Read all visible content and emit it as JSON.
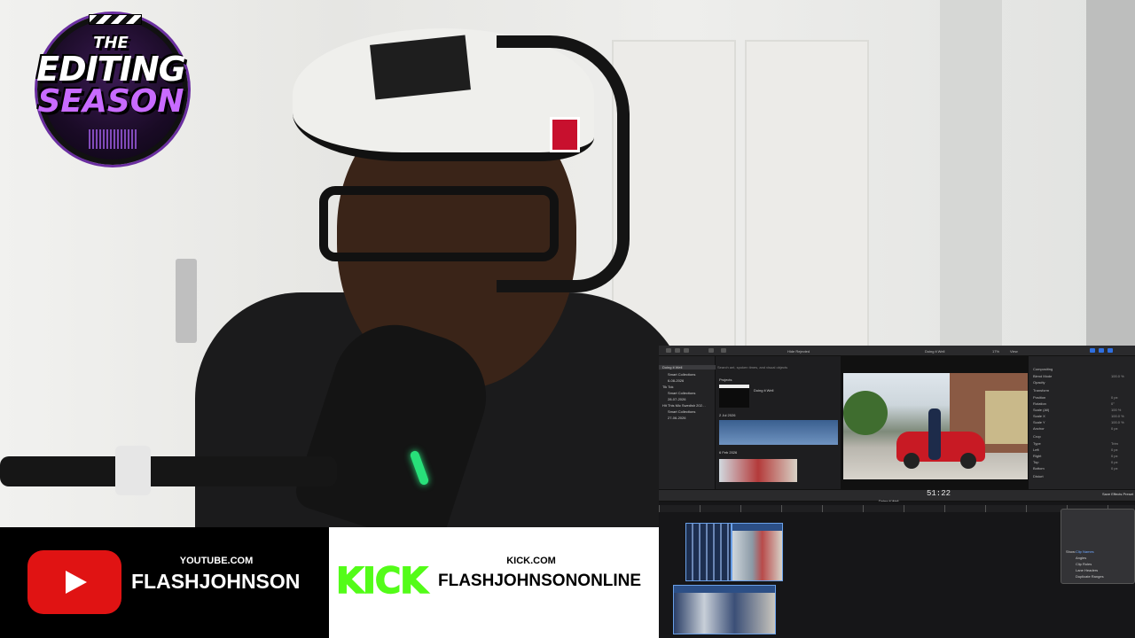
{
  "overlay": {
    "logo": {
      "line1": "THE",
      "line2": "EDITING",
      "line3": "SEASON"
    },
    "banner": {
      "youtube": {
        "platform_url": "YOUTUBE.COM",
        "channel": "FLASHJOHNSON",
        "brand_color": "#e01313"
      },
      "kick": {
        "logo_text": "KICK",
        "platform_url": "KICK.COM",
        "channel": "FLASHJOHNSONONLINE",
        "brand_color": "#53fc18"
      }
    }
  },
  "editor": {
    "toolbar": {
      "hide_rejected": "Hide Rejected",
      "project_name": "Doing it Well",
      "zoom": "17%",
      "view": "View"
    },
    "libraries": [
      {
        "label": "Doing it Well",
        "selected": true
      },
      {
        "label": "Smart Collections",
        "selected": false
      },
      {
        "label": "6-08-2026",
        "selected": false
      },
      {
        "label": "Tik Tok",
        "selected": false
      },
      {
        "label": "Smart Collections",
        "selected": false
      },
      {
        "label": "28-07-2026",
        "selected": false
      },
      {
        "label": "Hit This Mic Swedish 202…",
        "selected": false
      },
      {
        "label": "Smart Collections",
        "selected": false
      },
      {
        "label": "27-06-2026",
        "selected": false
      }
    ],
    "browser": {
      "search_placeholder": "Search ant, spoken times, and visual objects",
      "projects_heading": "Projects",
      "project_item": "Doing it Well",
      "group1": "2 Jul 2026",
      "group2": "6 Feb 2026",
      "status": "7 Items"
    },
    "viewer": {
      "timecode": "51:22"
    },
    "inspector": {
      "rows": [
        "Compositing",
        "Blend Mode",
        "Opacity",
        "Transform",
        "Position",
        "Rotation",
        "Scale (All)",
        "Scale X",
        "Scale Y",
        "Anchor",
        "Crop",
        "Type",
        "Left",
        "Right",
        "Top",
        "Bottom",
        "Distort"
      ],
      "values": [
        "Normal",
        "100.0 %",
        "",
        "",
        "0 px",
        "0°",
        "100 %",
        "100.0 %",
        "100.0 %",
        "0 px",
        "",
        "Trim",
        "0 px",
        "0 px",
        "0 px",
        "0 px",
        ""
      ]
    },
    "timeline": {
      "title": "Doing it Well",
      "save_preset": "Save Effects Preset"
    },
    "popover": {
      "show_label": "Show:",
      "options": [
        "Clip Names",
        "Angles",
        "Clip Roles",
        "Lane Headers",
        "Duplicate Ranges"
      ]
    }
  }
}
